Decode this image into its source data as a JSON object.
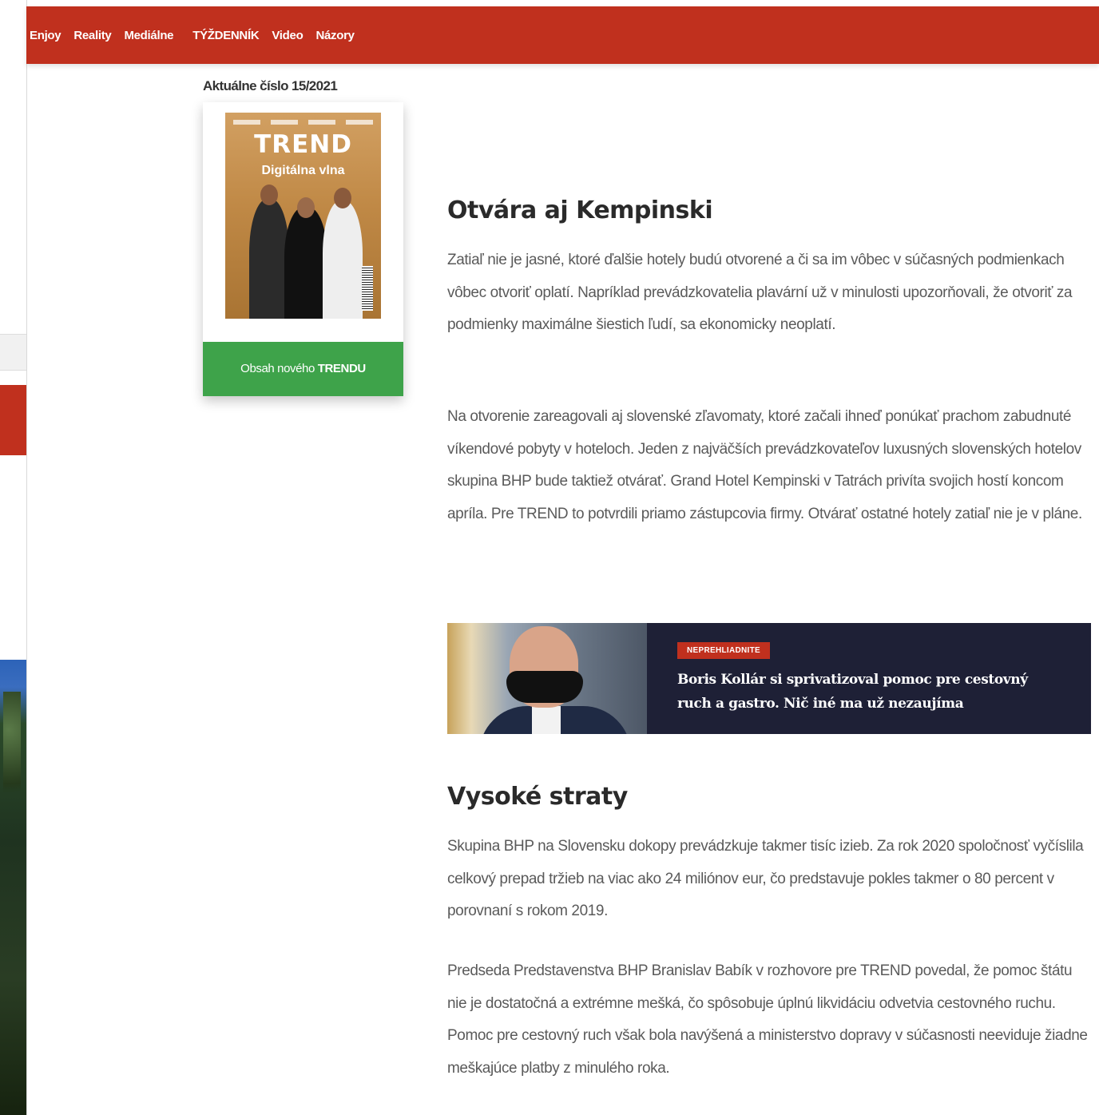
{
  "nav": {
    "items": [
      "Enjoy",
      "Reality",
      "Mediálne",
      "TÝŽDENNÍK",
      "Video",
      "Názory"
    ]
  },
  "sidebar": {
    "issue_label": "Aktuálne číslo 15/2021",
    "cover": {
      "logo": "TREND",
      "headline": "Digitálna vlna"
    },
    "button_prefix": "Obsah nového ",
    "button_bold": "TRENDU"
  },
  "article": {
    "heading1": "Otvára aj Kempinski",
    "p1": "Zatiaľ nie je jasné, ktoré ďalšie hotely budú otvorené a či sa im vôbec v súčasných podmienkach vôbec otvoriť oplatí. Napríklad prevádzkovatelia plavární už v minulosti upozorňovali, že otvoriť za podmienky maximálne šiestich ľudí, sa ekonomicky neoplatí.",
    "p2": "Na otvorenie zareagovali aj slovenské zľavomaty, ktoré začali ihneď ponúkať prachom zabudnuté víkendové pobyty v hoteloch. Jeden z najväčších prevádzkovateľov luxusných slovenských hotelov skupina BHP bude taktiež otvárať. Grand Hotel Kempinski v Tatrách privíta svojich hostí koncom apríla. Pre TREND to potvrdili priamo zástupcovia firmy. Otvárať ostatné hotely zatiaľ nie je v pláne.",
    "heading2": "Vysoké straty",
    "p3": "Skupina BHP na Slovensku dokopy prevádzkuje takmer tisíc izieb. Za rok 2020 spoločnosť vyčíslila celkový prepad tržieb na viac ako 24 miliónov eur, čo predstavuje pokles takmer o 80 percent v porovnaní s rokom 2019.",
    "p4": "Predseda Predstavenstva BHP Branislav Babík v rozhovore pre TREND povedal, že pomoc štátu nie je dostatočná a extrémne mešká, čo spôsobuje úplnú likvidáciu odvetvia cestovného ruchu. Pomoc pre cestovný ruch však bola navýšená a ministerstvo dopravy v súčasnosti neeviduje žiadne meškajúce platby z minulého roka."
  },
  "promo": {
    "badge": "NEPREHLIADNITE",
    "title": "Boris Kollár si sprivatizoval pomoc pre cestovný ruch a gastro. Nič iné ma už nezaujíma"
  },
  "colors": {
    "nav_red": "#c0301e",
    "button_green": "#3ea34a",
    "promo_navy": "#1e2036"
  }
}
